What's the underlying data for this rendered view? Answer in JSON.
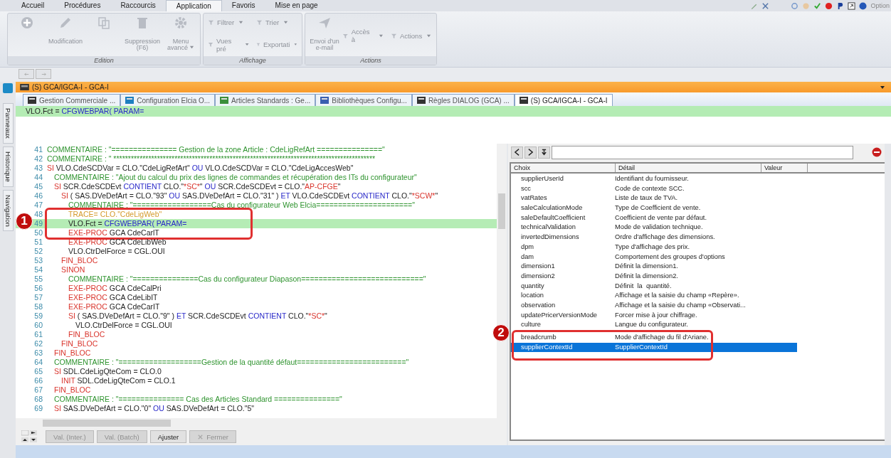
{
  "ribbon": {
    "tabs": [
      {
        "label": "Accueil",
        "selected": false
      },
      {
        "label": "Procédures",
        "selected": false
      },
      {
        "label": "Raccourcis",
        "selected": false
      },
      {
        "label": "Application",
        "selected": true
      },
      {
        "label": "Favoris",
        "selected": false
      },
      {
        "label": "Mise en page",
        "selected": false
      }
    ],
    "options_label": "Option",
    "groups": [
      {
        "title": "Edition",
        "large": [
          {
            "disabled": true
          },
          {
            "label": "Modification",
            "disabled": true
          },
          {
            "disabled": true
          },
          {
            "label": "Suppression (F6)",
            "disabled": true
          },
          {
            "label": "Menu avancé",
            "dropdown": true,
            "disabled": true
          }
        ]
      },
      {
        "title": "Affichage",
        "small": [
          {
            "label": "Filtrer",
            "dropdown": true,
            "disabled": true
          },
          {
            "label": "Trier",
            "dropdown": true,
            "disabled": true
          },
          {
            "label": "Vues pré",
            "dropdown": true,
            "disabled": true
          },
          {
            "label": "Exportati",
            "dropdown": true,
            "disabled": true
          }
        ]
      },
      {
        "title": "Actions",
        "large": [
          {
            "label": "Envoi d'un e-mail",
            "disabled": true
          }
        ],
        "small": [
          {
            "label": "Accès à",
            "dropdown": true,
            "disabled": true
          },
          {
            "label": "Actions",
            "dropdown": true,
            "disabled": true
          }
        ]
      }
    ]
  },
  "side_tabs": [
    "Panneaux",
    "Historique",
    "Navigation"
  ],
  "window_title": "(S) GCA/IGCA-I - GCA-I",
  "doc_tabs": [
    {
      "label": "Gestion Commerciale ...",
      "selected": false
    },
    {
      "label": "Configuration Elcia O...",
      "selected": false
    },
    {
      "label": "Articles Standards : Ge...",
      "selected": false
    },
    {
      "label": "Bibliothèques Configu...",
      "selected": false
    },
    {
      "label": "Règles DIALOG (GCA) ...",
      "selected": false
    },
    {
      "label": "(S) GCA/IGCA-I - GCA-I",
      "selected": true
    }
  ],
  "formula_bar": [
    {
      "kind": "plain",
      "text": "VLO.Fct = "
    },
    {
      "kind": "fn",
      "text": "CFGWEBPAR( PARAM="
    }
  ],
  "editor": {
    "callout_badge": "1",
    "lines": [
      {
        "num": "41",
        "current": false,
        "callout": false,
        "tokens": [
          {
            "kind": "cm",
            "text": "COMMENTAIRE : \"=============== Gestion de la zone Article : CdeLigRefArt ===============\""
          }
        ]
      },
      {
        "num": "42",
        "current": false,
        "callout": false,
        "tokens": [
          {
            "kind": "cm",
            "text": "COMMENTAIRE : \" ******************************************************************************************"
          }
        ]
      },
      {
        "num": "43",
        "current": false,
        "callout": false,
        "tokens": [
          {
            "kind": "kw",
            "text": "SI"
          },
          {
            "kind": "plain",
            "text": " VLO.CdeSCDVar = CLO.\"CdeLigRefArt\" "
          },
          {
            "kind": "op",
            "text": "OU"
          },
          {
            "kind": "plain",
            "text": " VLO.CdeSCDVar = CLO.\"CdeLigAccesWeb\""
          }
        ],
        "children": [
          {
            "num": "44",
            "current": false,
            "callout": false,
            "tokens": [
              {
                "kind": "cm",
                "text": "COMMENTAIRE : \"Ajout du calcul du prix des lignes de commandes et récupération des ITs du configurateur\""
              }
            ]
          },
          {
            "num": "45",
            "current": false,
            "callout": false,
            "tokens": [
              {
                "kind": "kw",
                "text": "SI"
              },
              {
                "kind": "plain",
                "text": " SCR.CdeSCDEvt "
              },
              {
                "kind": "op",
                "text": "CONTIENT"
              },
              {
                "kind": "plain",
                "text": " CLO.\""
              },
              {
                "kind": "str",
                "text": "*SC*"
              },
              {
                "kind": "plain",
                "text": "\" "
              },
              {
                "kind": "op",
                "text": "OU"
              },
              {
                "kind": "plain",
                "text": " SCR.CdeSCDEvt = CLO.\""
              },
              {
                "kind": "str",
                "text": "AP-CFGE"
              },
              {
                "kind": "plain",
                "text": "\""
              }
            ],
            "children": [
              {
                "num": "46",
                "current": false,
                "callout": false,
                "tokens": [
                  {
                    "kind": "kw",
                    "text": "SI"
                  },
                  {
                    "kind": "plain",
                    "text": " ( SAS.DVeDefArt = CLO.\"93\" "
                  },
                  {
                    "kind": "op",
                    "text": "OU"
                  },
                  {
                    "kind": "plain",
                    "text": " SAS.DVeDefArt = CLO.\"31\" ) "
                  },
                  {
                    "kind": "op",
                    "text": "ET"
                  },
                  {
                    "kind": "plain",
                    "text": " VLO.CdeSCDEvt "
                  },
                  {
                    "kind": "op",
                    "text": "CONTIENT"
                  },
                  {
                    "kind": "plain",
                    "text": " CLO.\""
                  },
                  {
                    "kind": "str",
                    "text": "*SCW*"
                  },
                  {
                    "kind": "plain",
                    "text": "\""
                  }
                ],
                "children": [
                  {
                    "num": "47",
                    "current": false,
                    "callout": false,
                    "tokens": [
                      {
                        "kind": "cm",
                        "text": "COMMENTAIRE : \"==================Cas du configurateur Web Elcia======================\""
                      }
                    ]
                  },
                  {
                    "num": "48",
                    "current": false,
                    "callout": true,
                    "tokens": [
                      {
                        "kind": "trace",
                        "text": "TRACE= CLO.\"CdeLigWeb\""
                      }
                    ]
                  },
                  {
                    "num": "49",
                    "current": true,
                    "callout": true,
                    "tokens": [
                      {
                        "kind": "plain",
                        "text": "VLO.Fct = "
                      },
                      {
                        "kind": "fn",
                        "text": "CFGWEBPAR( PARAM="
                      }
                    ]
                  },
                  {
                    "num": "50",
                    "current": false,
                    "callout": true,
                    "tokens": [
                      {
                        "kind": "kw",
                        "text": "EXE-PROC"
                      },
                      {
                        "kind": "plain",
                        "text": " GCA CdeCarlT"
                      }
                    ]
                  },
                  {
                    "num": "51",
                    "current": false,
                    "callout": false,
                    "tokens": [
                      {
                        "kind": "kw",
                        "text": "EXE-PROC"
                      },
                      {
                        "kind": "plain",
                        "text": " GCA CdeLibWeb"
                      }
                    ]
                  },
                  {
                    "num": "52",
                    "current": false,
                    "callout": false,
                    "tokens": [
                      {
                        "kind": "plain",
                        "text": "VLO.CtrDelForce = CGL.OUI"
                      }
                    ]
                  }
                ]
              },
              {
                "num": "53",
                "current": false,
                "callout": false,
                "tokens": [
                  {
                    "kind": "kw",
                    "text": "FIN_BLOC"
                  }
                ]
              },
              {
                "num": "54",
                "current": false,
                "callout": false,
                "tokens": [
                  {
                    "kind": "kw",
                    "text": "SINON"
                  }
                ],
                "children": [
                  {
                    "num": "55",
                    "current": false,
                    "callout": false,
                    "tokens": [
                      {
                        "kind": "cm",
                        "text": "COMMENTAIRE : \"===============Cas du configurateur Diapason============================\""
                      }
                    ]
                  },
                  {
                    "num": "56",
                    "current": false,
                    "callout": false,
                    "tokens": [
                      {
                        "kind": "kw",
                        "text": "EXE-PROC"
                      },
                      {
                        "kind": "plain",
                        "text": " GCA CdeCalPri"
                      }
                    ]
                  },
                  {
                    "num": "57",
                    "current": false,
                    "callout": false,
                    "tokens": [
                      {
                        "kind": "kw",
                        "text": "EXE-PROC"
                      },
                      {
                        "kind": "plain",
                        "text": " GCA CdeLibIT"
                      }
                    ]
                  },
                  {
                    "num": "58",
                    "current": false,
                    "callout": false,
                    "tokens": [
                      {
                        "kind": "kw",
                        "text": "EXE-PROC"
                      },
                      {
                        "kind": "plain",
                        "text": " GCA CdeCarIT"
                      }
                    ]
                  },
                  {
                    "num": "59",
                    "current": false,
                    "callout": false,
                    "tokens": [
                      {
                        "kind": "kw",
                        "text": "SI"
                      },
                      {
                        "kind": "plain",
                        "text": " ( SAS.DVeDefArt = CLO.\"9\" ) "
                      },
                      {
                        "kind": "op",
                        "text": "ET"
                      },
                      {
                        "kind": "plain",
                        "text": " SCR.CdeSCDEvt "
                      },
                      {
                        "kind": "op",
                        "text": "CONTIENT"
                      },
                      {
                        "kind": "plain",
                        "text": " CLO.\""
                      },
                      {
                        "kind": "str",
                        "text": "*SC*"
                      },
                      {
                        "kind": "plain",
                        "text": "\""
                      }
                    ],
                    "children": [
                      {
                        "num": "60",
                        "current": false,
                        "callout": false,
                        "tokens": [
                          {
                            "kind": "plain",
                            "text": "VLO.CtrDelForce = CGL.OUI"
                          }
                        ]
                      }
                    ]
                  },
                  {
                    "num": "61",
                    "current": false,
                    "callout": false,
                    "tokens": [
                      {
                        "kind": "kw",
                        "text": "FIN_BLOC"
                      }
                    ]
                  }
                ]
              },
              {
                "num": "62",
                "current": false,
                "callout": false,
                "tokens": [
                  {
                    "kind": "kw",
                    "text": "FIN_BLOC"
                  }
                ]
              }
            ]
          },
          {
            "num": "63",
            "current": false,
            "callout": false,
            "tokens": [
              {
                "kind": "kw",
                "text": "FIN_BLOC"
              }
            ]
          },
          {
            "num": "64",
            "current": false,
            "callout": false,
            "tokens": [
              {
                "kind": "cm",
                "text": "COMMENTAIRE : \"===================Gestion de la quantité défaut=========================\""
              }
            ]
          },
          {
            "num": "65",
            "current": false,
            "callout": false,
            "tokens": [
              {
                "kind": "kw",
                "text": "SI"
              },
              {
                "kind": "plain",
                "text": " SDL.CdeLigQteCom = CLO.0"
              }
            ],
            "children": [
              {
                "num": "66",
                "current": false,
                "callout": false,
                "tokens": [
                  {
                    "kind": "kw",
                    "text": "INIT"
                  },
                  {
                    "kind": "plain",
                    "text": " SDL.CdeLigQteCom = CLO.1"
                  }
                ]
              }
            ]
          },
          {
            "num": "67",
            "current": false,
            "callout": false,
            "tokens": [
              {
                "kind": "kw",
                "text": "FIN_BLOC"
              }
            ]
          },
          {
            "num": "68",
            "current": false,
            "callout": false,
            "tokens": [
              {
                "kind": "cm",
                "text": "COMMENTAIRE : \"=============== Cas des Articles Standard ===============\""
              }
            ]
          },
          {
            "num": "69",
            "current": false,
            "callout": false,
            "tokens": [
              {
                "kind": "kw",
                "text": "SI"
              },
              {
                "kind": "plain",
                "text": " SAS.DVeDefArt = CLO.\"0\" "
              },
              {
                "kind": "op",
                "text": "OU"
              },
              {
                "kind": "plain",
                "text": " SAS.DVeDefArt = CLO.\"5\""
              }
            ]
          }
        ]
      }
    ]
  },
  "bottom_buttons": [
    {
      "label": "Val. (Inter.)",
      "disabled": true
    },
    {
      "label": "Val. (Batch)",
      "disabled": true
    },
    {
      "label": "Ajuster",
      "disabled": false
    },
    {
      "label": "Fermer",
      "disabled": true,
      "kind": "close"
    }
  ],
  "choices": {
    "callout_badge": "2",
    "columns": [
      "Choix",
      "Détail",
      "Valeur"
    ],
    "rows": [
      {
        "choice": "supplierUserId",
        "detail": "Identifiant du fournisseur.",
        "selected": false,
        "callout": false
      },
      {
        "choice": "scc",
        "detail": "Code de contexte SCC.",
        "selected": false,
        "callout": false
      },
      {
        "choice": "vatRates",
        "detail": "Liste de taux de TVA.",
        "selected": false,
        "callout": false
      },
      {
        "choice": "saleCalculationMode",
        "detail": "Type de Coefficient de vente.",
        "selected": false,
        "callout": false
      },
      {
        "choice": "saleDefaultCoefficient",
        "detail": "Coefficient de vente par défaut.",
        "selected": false,
        "callout": false
      },
      {
        "choice": "technicalValidation",
        "detail": "Mode de validation technique.",
        "selected": false,
        "callout": false
      },
      {
        "choice": "invertedDimensions",
        "detail": "Ordre d'affichage des dimensions.",
        "selected": false,
        "callout": false
      },
      {
        "choice": "dpm",
        "detail": "Type d'affichage des prix.",
        "selected": false,
        "callout": false
      },
      {
        "choice": "dam",
        "detail": "Comportement des groupes d'options",
        "selected": false,
        "callout": false
      },
      {
        "choice": "dimension1",
        "detail": "Définit la dimension1.",
        "selected": false,
        "callout": false
      },
      {
        "choice": "dimension2",
        "detail": "Définit la dimension2.",
        "selected": false,
        "callout": false
      },
      {
        "choice": "quantity",
        "detail": "Définit  la  quantité.",
        "selected": false,
        "callout": false
      },
      {
        "choice": "location",
        "detail": "Affichage et la saisie du champ «Repère».",
        "selected": false,
        "callout": false
      },
      {
        "choice": "observation",
        "detail": "Affichage et la saisie du champ «Observati...",
        "selected": false,
        "callout": false
      },
      {
        "choice": "updatePricerVersionMode",
        "detail": "Forcer mise à jour chiffrage.",
        "selected": false,
        "callout": false
      },
      {
        "choice": "culture",
        "detail": "Langue du configurateur.",
        "selected": false,
        "callout": false
      },
      {
        "choice": "breadcrumb",
        "detail": "Mode d'affichage du fil d'Ariane.",
        "selected": false,
        "callout": true
      },
      {
        "choice": "supplierContextId",
        "detail": "SupplierContextId",
        "selected": true,
        "callout": true
      }
    ]
  }
}
